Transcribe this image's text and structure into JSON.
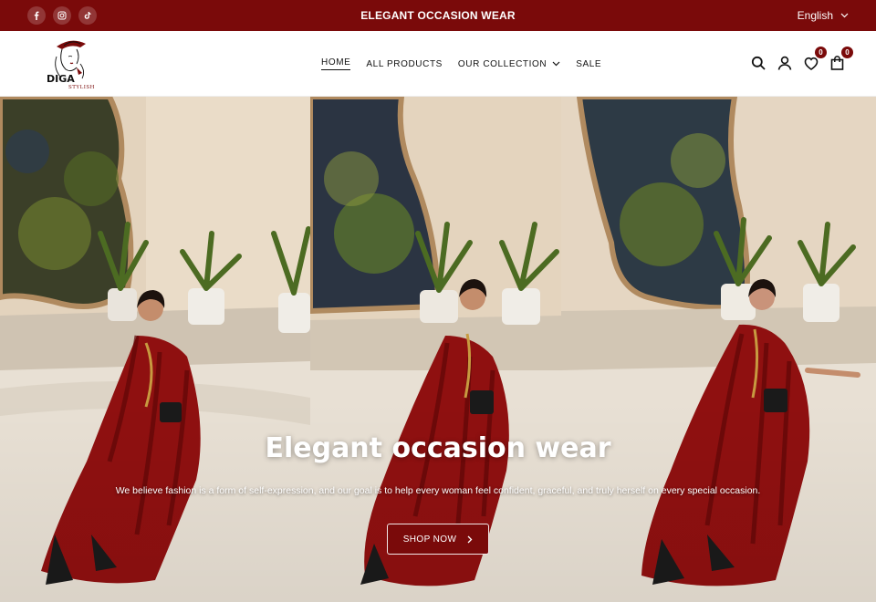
{
  "announcement": "ELEGANT OCCASION WEAR",
  "social": [
    "facebook-icon",
    "instagram-icon",
    "tiktok-icon"
  ],
  "language": "English",
  "brand": {
    "name": "DIGA",
    "tagline": "STYLISH"
  },
  "nav": [
    {
      "label": "HOME",
      "active": true
    },
    {
      "label": "ALL PRODUCTS"
    },
    {
      "label": "OUR COLLECTION",
      "dropdown": true
    },
    {
      "label": "SALE"
    }
  ],
  "header_icons": {
    "search": "search-icon",
    "account": "user-icon",
    "wishlist_count": "0",
    "cart_count": "0"
  },
  "hero": {
    "title": "Elegant occasion wear",
    "subtitle": "We believe fashion is a form of self-expression, and our goal is to help every woman feel confident, graceful, and truly herself on every special occasion.",
    "cta": "SHOP NOW"
  },
  "colors": {
    "brand": "#7a0a0a",
    "dress": "#8f1010",
    "wall": "#e6d8c4"
  }
}
